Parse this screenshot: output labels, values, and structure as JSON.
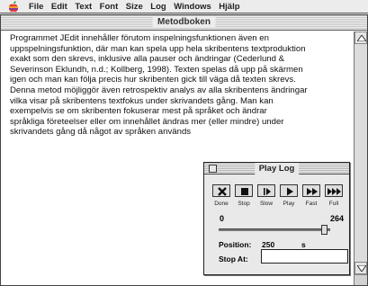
{
  "menubar": {
    "apple_icon": "apple-logo-icon",
    "items": [
      "File",
      "Edit",
      "Text",
      "Font",
      "Size",
      "Log",
      "Windows",
      "Hjälp"
    ]
  },
  "document": {
    "title": "Metodboken",
    "lines": [
      "Programmet JEdit innehåller förutom inspelningsfunktionen även en",
      "uppspelningsfunktion, där man kan spela upp hela skribentens textproduktion",
      "exakt som den skrevs, inklusive alla pauser och ändringar (Cederlund &",
      "Severinson Eklundh, n.d.; Kollberg, 1998). Texten spelas då upp på skärmen",
      "igen och man kan följa precis hur skribenten gick till väga då texten skrevs.",
      "Denna metod möjliggör även retrospektiv analys av alla skribentens ändringar",
      "vilka visar på skribentens textfokus under skrivandets gång. Man kan",
      "exempelvis se om skribenten fokuserar mest på språket och ändrar",
      "språkliga företeelser eller om innehållet ändras mer (eller mindre) under",
      "skrivandets gång då något av språken används"
    ]
  },
  "playlog": {
    "title": "Play Log",
    "buttons": [
      {
        "label": "Done",
        "icon": "close-x-icon"
      },
      {
        "label": "Stop",
        "icon": "stop-square-icon"
      },
      {
        "label": "Slow",
        "icon": "slow-play-icon"
      },
      {
        "label": "Play",
        "icon": "play-triangle-icon"
      },
      {
        "label": "Fast",
        "icon": "fast-forward-icon"
      },
      {
        "label": "Full",
        "icon": "full-speed-icon"
      }
    ],
    "slider_min": "0",
    "slider_max": "264",
    "slider_fraction": 0.947,
    "position_label": "Position:",
    "position_value": "250",
    "position_unit": "s",
    "stop_at_label": "Stop At:",
    "stop_at_value": ""
  }
}
